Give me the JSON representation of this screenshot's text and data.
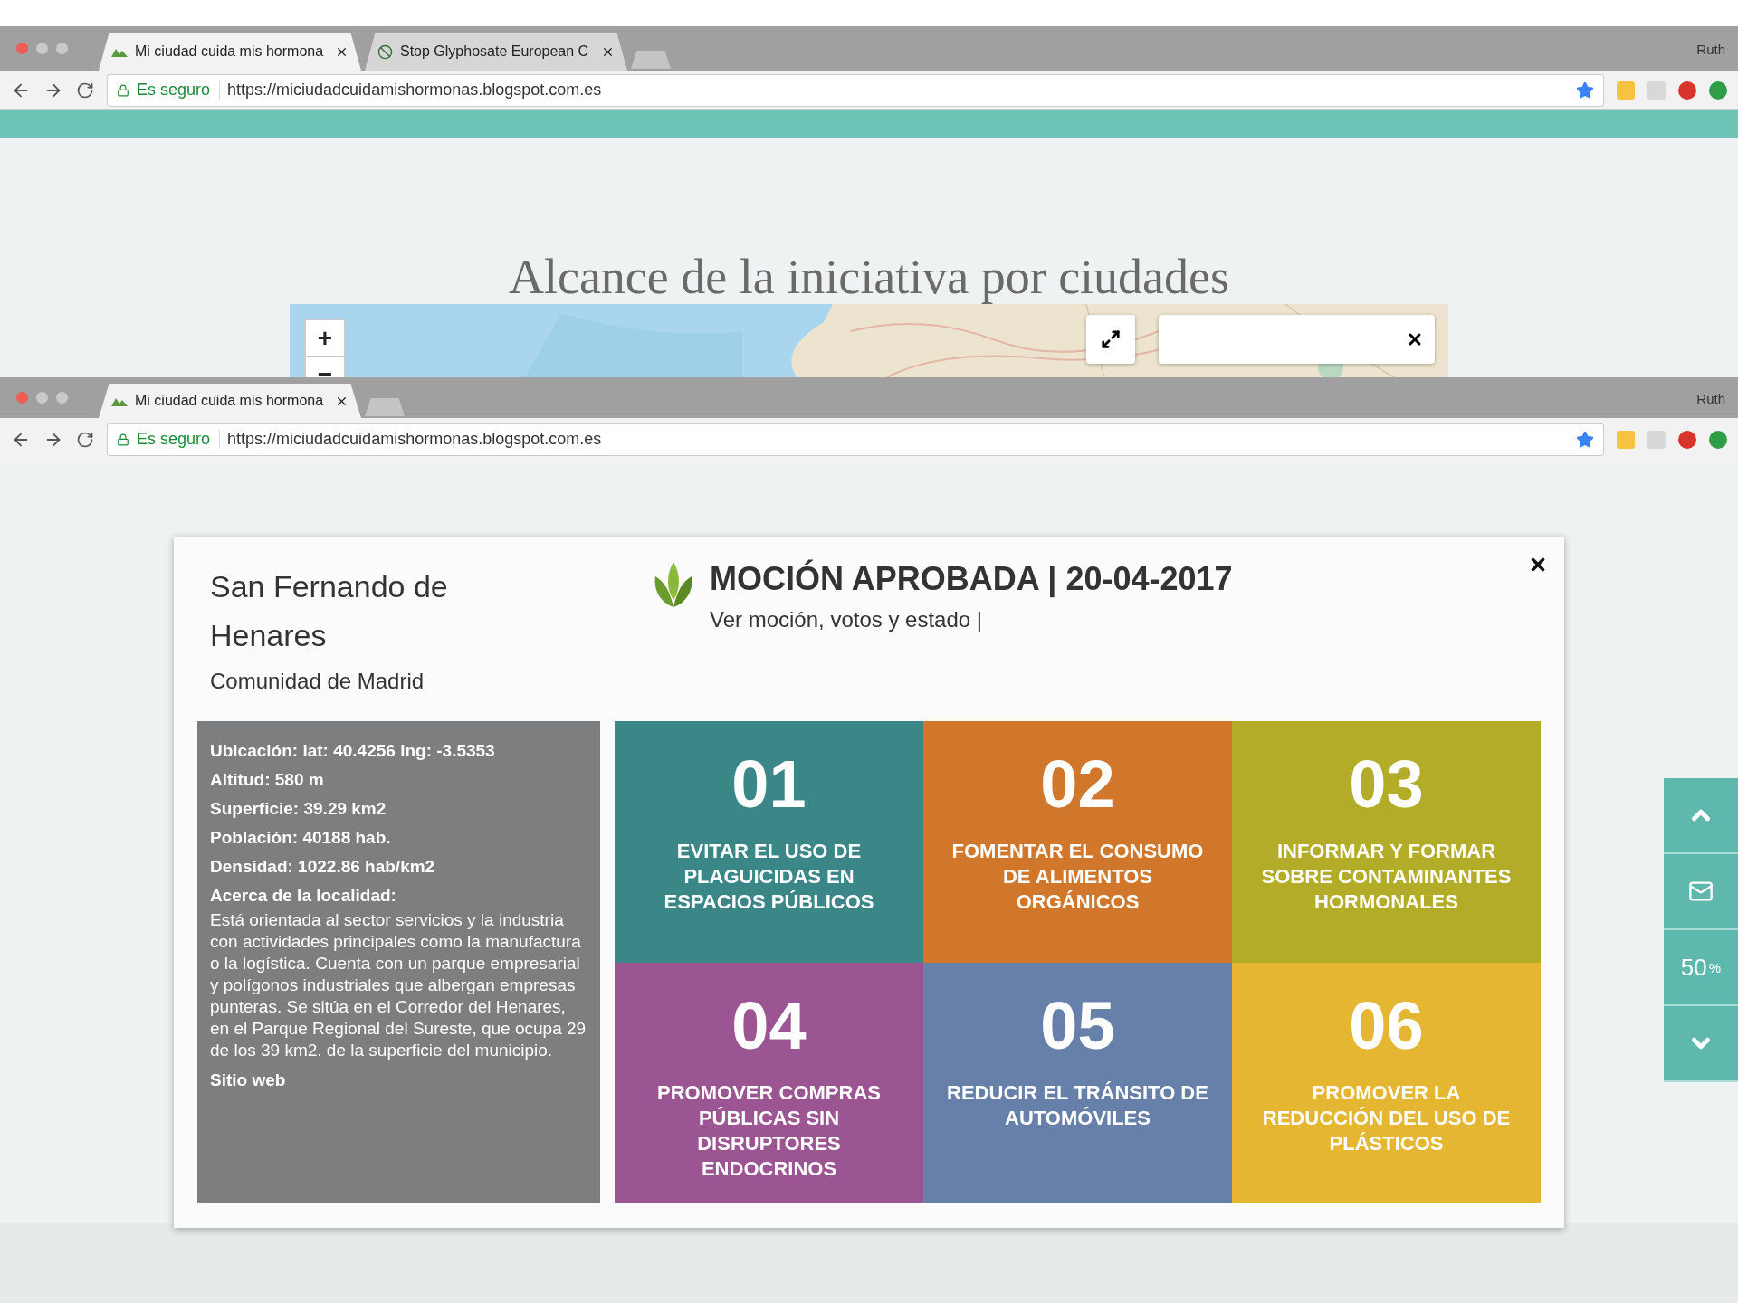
{
  "browser_windows": [
    {
      "tabs": [
        {
          "title": "Mi ciudad cuida mis hormona",
          "kind": "blog",
          "selected": true
        },
        {
          "title": "Stop Glyphosate European C",
          "kind": "petition",
          "selected": false
        }
      ],
      "profile": "Ruth",
      "security_label": "Es seguro",
      "url": "https://miciudadcuidamishormonas.blogspot.com.es"
    },
    {
      "tabs": [
        {
          "title": "Mi ciudad cuida mis hormona",
          "kind": "blog",
          "selected": true
        }
      ],
      "profile": "Ruth",
      "security_label": "Es seguro",
      "url": "https://miciudadcuidamishormonas.blogspot.com.es"
    }
  ],
  "page_heading": "Alcance de la iniciativa por ciudades",
  "map": {
    "zoom_in": "+",
    "zoom_out": "−"
  },
  "modal": {
    "city": "San Fernando de Henares",
    "region": "Comunidad de Madrid",
    "status": "MOCIÓN APROBADA | 20-04-2017",
    "status_link": "Ver moción, votos y estado |",
    "facts": [
      "Ubicación: lat: 40.4256 lng: -3.5353",
      "Altitud: 580 m",
      "Superficie: 39.29 km2",
      "Población: 40188 hab.",
      "Densidad: 1022.86 hab/km2"
    ],
    "about_label": "Acerca de la localidad:",
    "about_text": "Está orientada al sector servicios y la industria con actividades principales como la manufactura o la logística. Cuenta con un parque empresarial y polígonos industriales que albergan empresas punteras. Se sitúa en el Corredor del Henares, en el Parque Regional del Sureste, que ocupa 29 de los 39 km2. de la superficie del municipio.",
    "website_link": "Sitio web",
    "commitments": [
      {
        "number": "01",
        "text": "EVITAR EL USO DE PLAGUICIDAS EN ESPACIOS PÚBLICOS",
        "color": "#3b8788"
      },
      {
        "number": "02",
        "text": "FOMENTAR EL CONSUMO DE ALIMENTOS ORGÁNICOS",
        "color": "#d1772c"
      },
      {
        "number": "03",
        "text": "INFORMAR Y FORMAR SOBRE CONTAMINANTES HORMONALES",
        "color": "#b3ac29"
      },
      {
        "number": "04",
        "text": "PROMOVER COMPRAS PÚBLICAS SIN DISRUPTORES ENDOCRINOS",
        "color": "#9b5592"
      },
      {
        "number": "05",
        "text": "REDUCIR EL TRÁNSITO DE AUTOMÓVILES",
        "color": "#6680aa"
      },
      {
        "number": "06",
        "text": "PROMOVER LA REDUCCIÓN DEL USO DE PLÁSTICOS",
        "color": "#e5b632"
      }
    ]
  },
  "side_panel": {
    "zoom_value": "50",
    "zoom_unit": "%"
  }
}
